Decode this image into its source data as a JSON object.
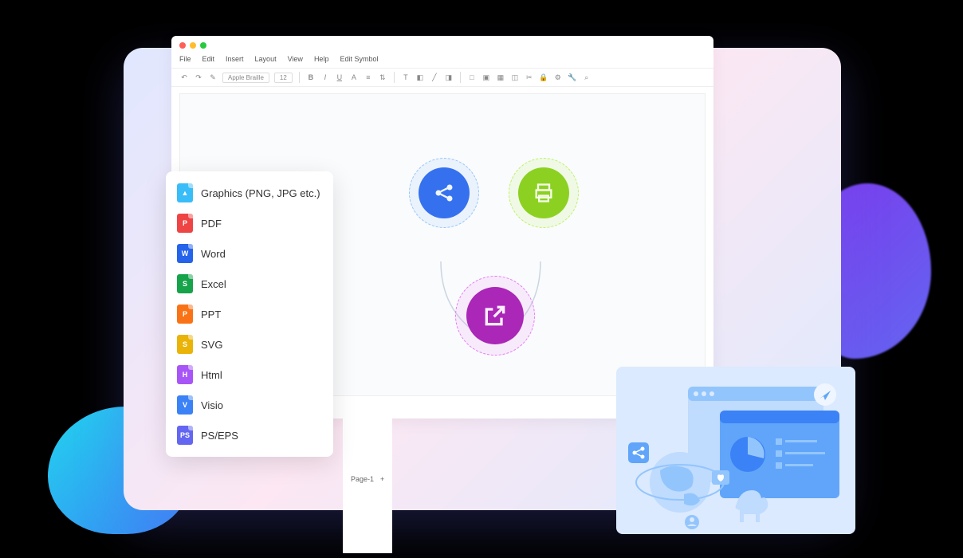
{
  "menu": {
    "items": [
      "File",
      "Edit",
      "Insert",
      "Layout",
      "View",
      "Help",
      "Edit Symbol"
    ]
  },
  "toolbar": {
    "font": "Apple Braille",
    "size": "12"
  },
  "page_tab": "Page-1",
  "export_menu": {
    "items": [
      {
        "label": "Graphics (PNG, JPG etc.)",
        "icon": "image",
        "color": "#38bdf8"
      },
      {
        "label": "PDF",
        "icon": "pdf",
        "color": "#ef4444"
      },
      {
        "label": "Word",
        "icon": "word",
        "color": "#2563eb"
      },
      {
        "label": "Excel",
        "icon": "excel",
        "color": "#16a34a"
      },
      {
        "label": "PPT",
        "icon": "ppt",
        "color": "#f97316"
      },
      {
        "label": "SVG",
        "icon": "svg",
        "color": "#eab308"
      },
      {
        "label": "Html",
        "icon": "html",
        "color": "#a855f7"
      },
      {
        "label": "Visio",
        "icon": "visio",
        "color": "#3b82f6"
      },
      {
        "label": "PS/EPS",
        "icon": "ps",
        "color": "#6366f1"
      }
    ]
  },
  "nodes": {
    "share": "share",
    "print": "print",
    "export": "export"
  }
}
